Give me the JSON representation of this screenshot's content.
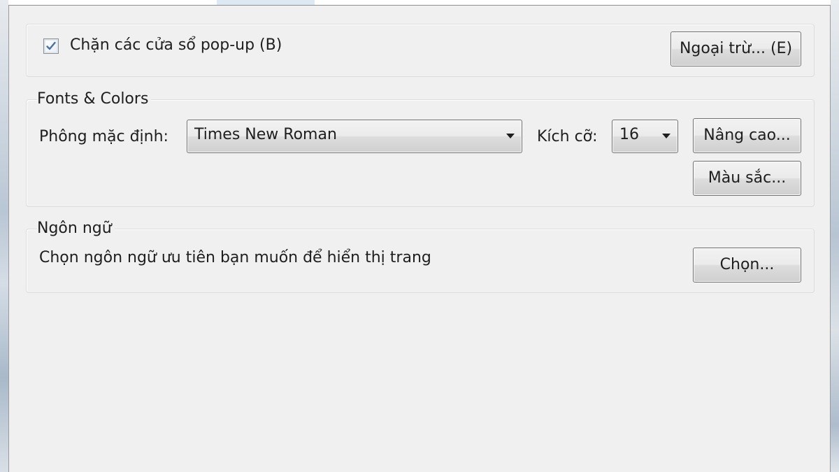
{
  "popup_group": {
    "block_popups_label": "Chặn các cửa sổ pop-up (B)",
    "block_popups_checked": true,
    "exceptions_button": "Ngoại trừ... (E)"
  },
  "fonts_group": {
    "title": "Fonts & Colors",
    "default_font_label": "Phông mặc định:",
    "default_font_value": "Times New Roman",
    "size_label": "Kích cỡ:",
    "size_value": "16",
    "advanced_button": "Nâng cao...",
    "colors_button": "Màu sắc..."
  },
  "language_group": {
    "title": "Ngôn ngữ",
    "description": "Chọn ngôn ngữ ưu tiên bạn muốn để hiển thị trang",
    "choose_button": "Chọn..."
  },
  "icons": {
    "checkmark": "checkmark-icon",
    "dropdown_arrow": "chevron-down-icon"
  },
  "colors": {
    "dialog_background": "#f0f0f0",
    "button_border": "#707070",
    "checkmark": "#4a6fa5"
  }
}
